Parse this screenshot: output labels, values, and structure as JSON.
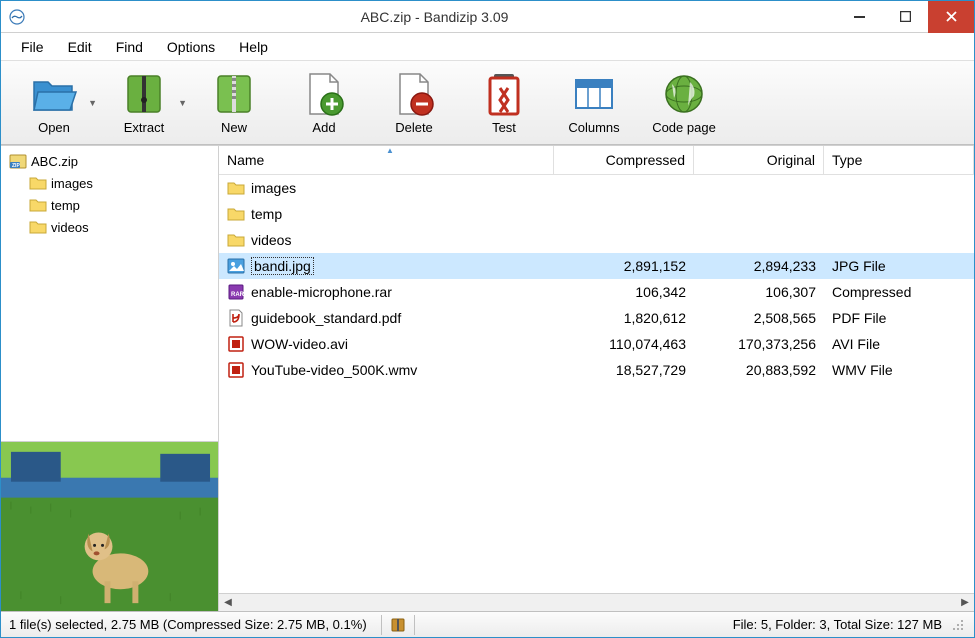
{
  "window": {
    "title": "ABC.zip - Bandizip 3.09"
  },
  "menu": {
    "items": [
      "File",
      "Edit",
      "Find",
      "Options",
      "Help"
    ]
  },
  "toolbar": {
    "open": "Open",
    "extract": "Extract",
    "new": "New",
    "add": "Add",
    "delete": "Delete",
    "test": "Test",
    "columns": "Columns",
    "codepage": "Code page"
  },
  "tree": {
    "root": "ABC.zip",
    "children": [
      "images",
      "temp",
      "videos"
    ]
  },
  "columns": {
    "name": "Name",
    "compressed": "Compressed",
    "original": "Original",
    "type": "Type"
  },
  "files": [
    {
      "name": "images",
      "kind": "folder",
      "compressed": "",
      "original": "",
      "type": ""
    },
    {
      "name": "temp",
      "kind": "folder",
      "compressed": "",
      "original": "",
      "type": ""
    },
    {
      "name": "videos",
      "kind": "folder",
      "compressed": "",
      "original": "",
      "type": ""
    },
    {
      "name": "bandi.jpg",
      "kind": "image",
      "compressed": "2,891,152",
      "original": "2,894,233",
      "type": "JPG File",
      "selected": true
    },
    {
      "name": "enable-microphone.rar",
      "kind": "rar",
      "compressed": "106,342",
      "original": "106,307",
      "type": "Compressed"
    },
    {
      "name": "guidebook_standard.pdf",
      "kind": "pdf",
      "compressed": "1,820,612",
      "original": "2,508,565",
      "type": "PDF File"
    },
    {
      "name": "WOW-video.avi",
      "kind": "video",
      "compressed": "110,074,463",
      "original": "170,373,256",
      "type": "AVI File"
    },
    {
      "name": "YouTube-video_500K.wmv",
      "kind": "video",
      "compressed": "18,527,729",
      "original": "20,883,592",
      "type": "WMV File"
    }
  ],
  "status": {
    "selection": "1 file(s) selected, 2.75 MB (Compressed Size: 2.75 MB, 0.1%)",
    "totals": "File: 5, Folder: 3, Total Size: 127 MB"
  }
}
